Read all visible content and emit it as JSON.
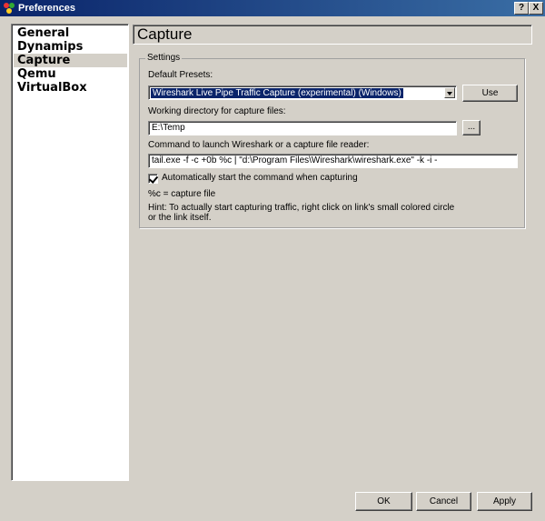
{
  "window": {
    "title": "Preferences",
    "help_label": "?",
    "close_label": "X"
  },
  "sidebar": {
    "items": [
      {
        "label": "General",
        "selected": false
      },
      {
        "label": "Dynamips",
        "selected": false
      },
      {
        "label": "Capture",
        "selected": true
      },
      {
        "label": "Qemu",
        "selected": false
      },
      {
        "label": "VirtualBox",
        "selected": false
      }
    ]
  },
  "page": {
    "title": "Capture"
  },
  "settings": {
    "group_label": "Settings",
    "presets_label": "Default Presets:",
    "presets_value": "Wireshark Live Pipe Traffic Capture (experimental) (Windows)",
    "use_label": "Use",
    "workdir_label": "Working directory for capture files:",
    "workdir_value": "E:\\Temp",
    "browse_label": "...",
    "command_label": "Command to launch Wireshark or a capture file reader:",
    "command_value": "tail.exe -f -c +0b %c | \"d:\\Program Files\\Wireshark\\wireshark.exe\" -k -i -",
    "autostart_label": "Automatically start the command when capturing",
    "autostart_checked": true,
    "note_capture": "%c = capture file",
    "hint_line1": "Hint: To actually start capturing traffic, right click on link's small colored circle",
    "hint_line2": "or the link itself."
  },
  "footer": {
    "ok_label": "OK",
    "cancel_label": "Cancel",
    "apply_label": "Apply"
  },
  "colors": {
    "title_bar": "#0a246a",
    "dialog_bg": "#d4d0c8",
    "selection": "#0a246a"
  }
}
